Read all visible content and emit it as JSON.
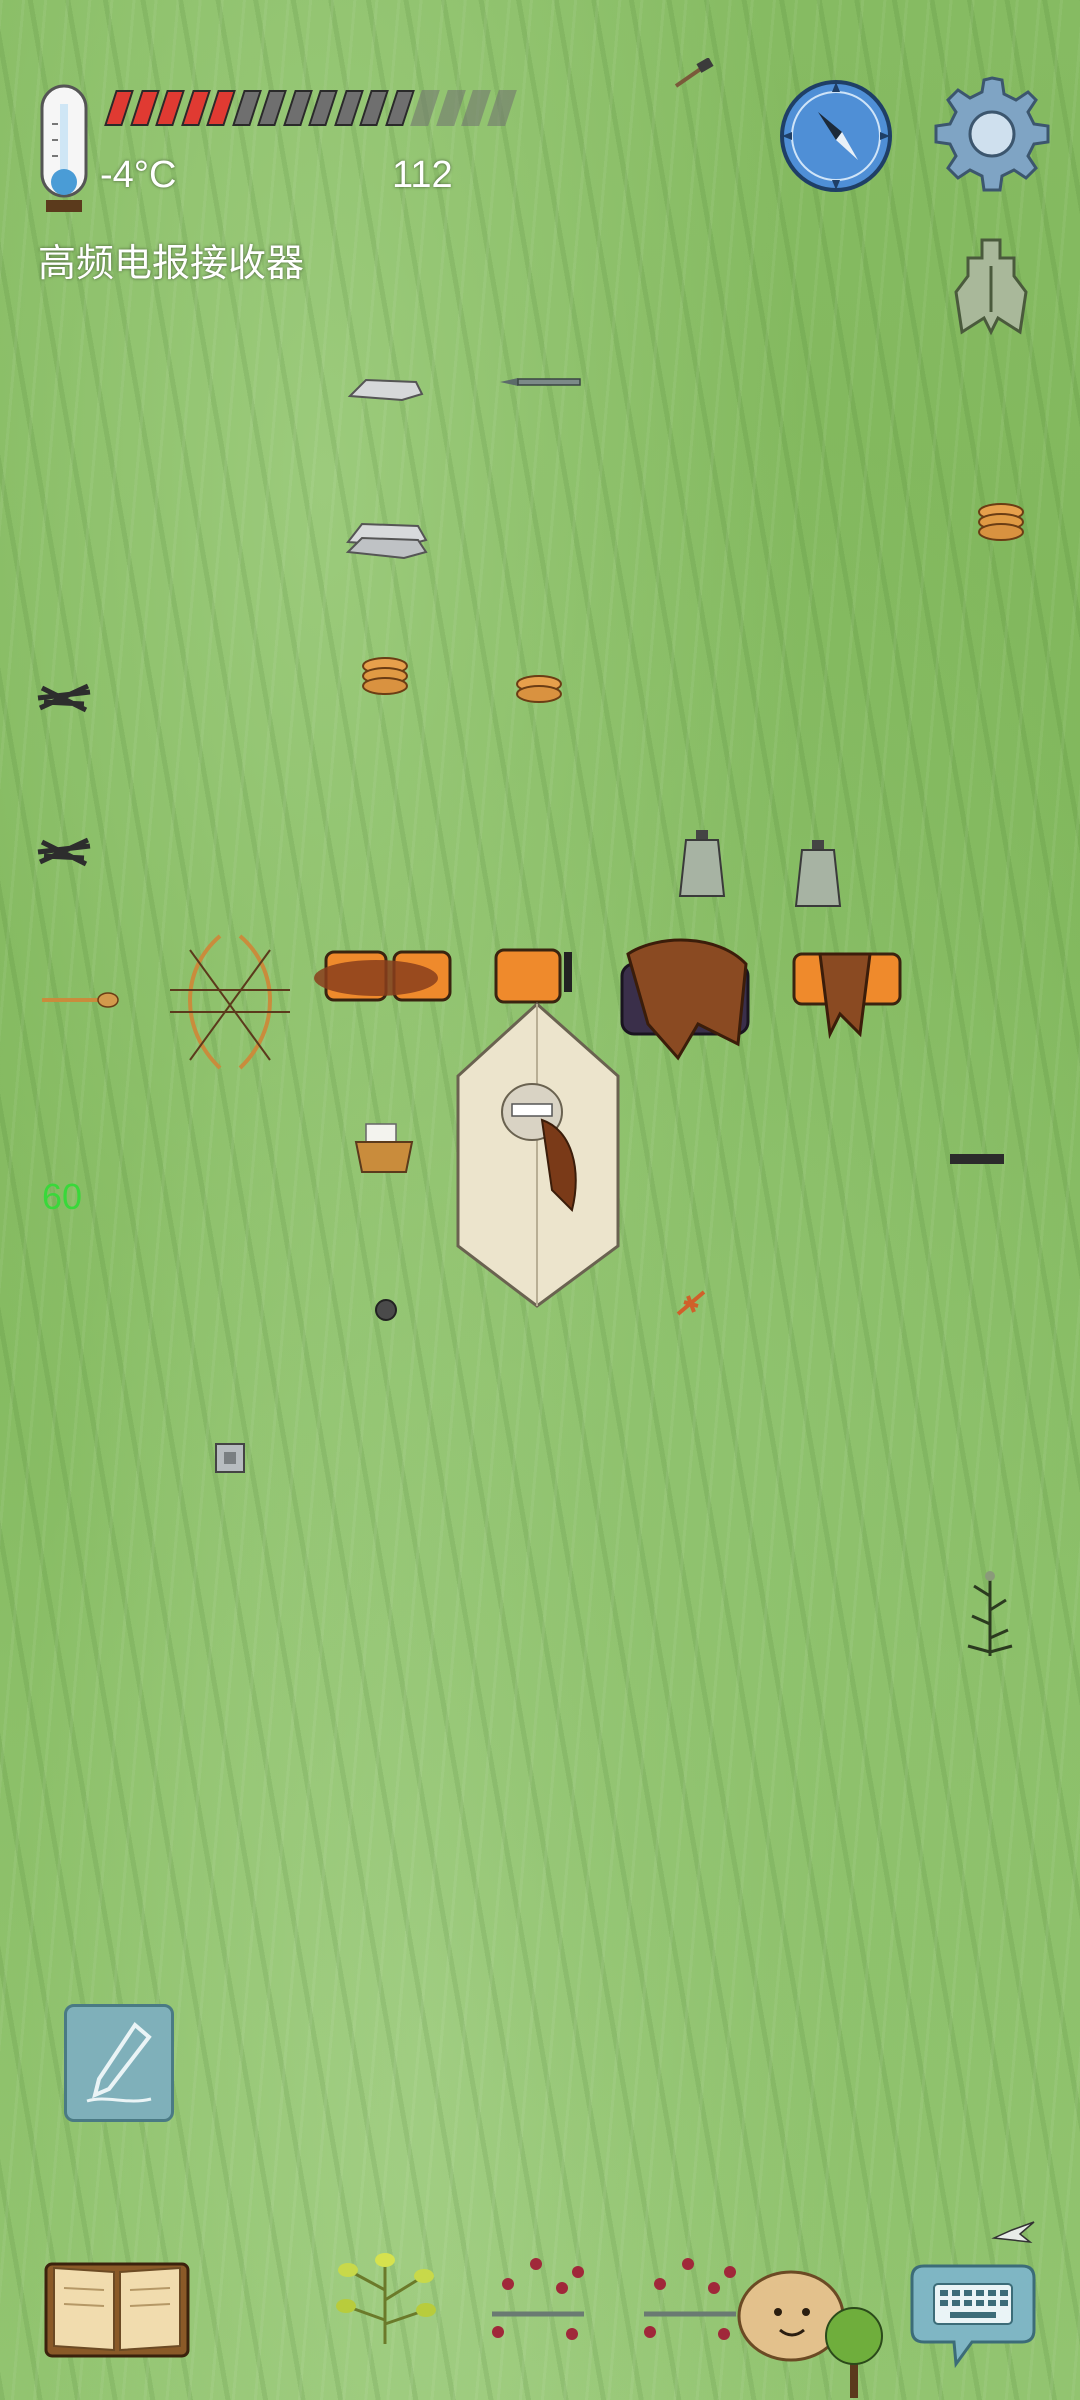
{
  "hud": {
    "temperature": "-4°C",
    "counter": "112",
    "location": "高频电报接收器",
    "fps": "60",
    "health_segments_filled": 5,
    "health_segments_total": 16
  },
  "colors": {
    "grass": "#86bb62",
    "health_fill": "#e03a32",
    "health_empty": "#6f6f6f",
    "compass_blue": "#4f8fd6",
    "fps_green": "#39d83a",
    "chat_bubble": "#7fb6c4"
  },
  "icons": {
    "thermometer": "thermometer-icon",
    "compass": "compass-icon",
    "settings": "gear-icon",
    "map_token": "spade-coin-icon",
    "edit": "pencil-icon",
    "journal": "open-book-icon",
    "chat": "keyboard-chat-icon"
  }
}
